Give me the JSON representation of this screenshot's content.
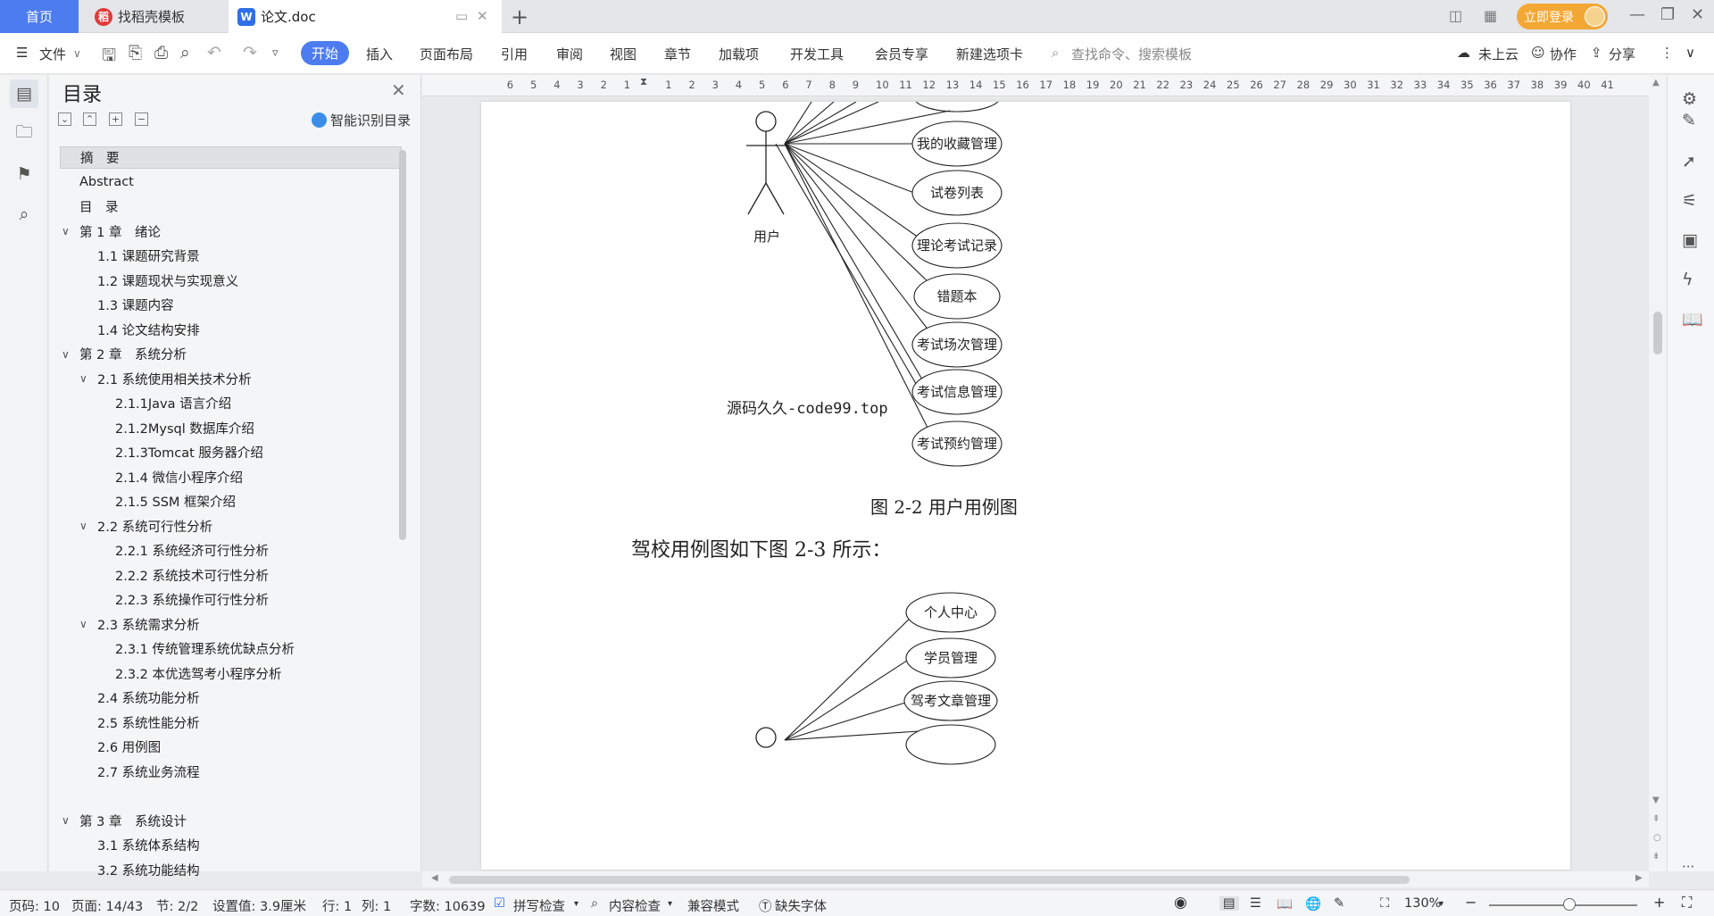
{
  "tabs": {
    "home": "首页",
    "template": "找稻壳模板",
    "doc": "论文.doc",
    "add": "+"
  },
  "titlebar": {
    "login": "立即登录"
  },
  "menu": {
    "file": "文件",
    "items": [
      "开始",
      "插入",
      "页面布局",
      "引用",
      "审阅",
      "视图",
      "章节",
      "加载项",
      "开发工具",
      "会员专享",
      "新建选项卡"
    ],
    "search_placeholder": "查找命令、搜索模板",
    "cloud": "未上云",
    "collab": "协作",
    "share": "分享"
  },
  "toc": {
    "title": "目录",
    "smart": "智能识别目录",
    "items": [
      {
        "label": "摘　要",
        "level": 0,
        "caret": false,
        "selected": true
      },
      {
        "label": "Abstract",
        "level": 0,
        "caret": false
      },
      {
        "label": "目　录",
        "level": 0,
        "caret": false
      },
      {
        "label": "第 1 章　绪论",
        "level": 0,
        "caret": true
      },
      {
        "label": "1.1 课题研究背景",
        "level": 1,
        "caret": false
      },
      {
        "label": "1.2 课题现状与实现意义",
        "level": 1,
        "caret": false
      },
      {
        "label": "1.3 课题内容",
        "level": 1,
        "caret": false
      },
      {
        "label": "1.4 论文结构安排",
        "level": 1,
        "caret": false
      },
      {
        "label": "第 2 章　系统分析",
        "level": 0,
        "caret": true
      },
      {
        "label": "2.1 系统使用相关技术分析",
        "level": 1,
        "caret": true
      },
      {
        "label": "2.1.1Java 语言介绍",
        "level": 2,
        "caret": false
      },
      {
        "label": "2.1.2Mysql 数据库介绍",
        "level": 2,
        "caret": false
      },
      {
        "label": "2.1.3Tomcat 服务器介绍",
        "level": 2,
        "caret": false
      },
      {
        "label": "2.1.4 微信小程序介绍",
        "level": 2,
        "caret": false
      },
      {
        "label": "2.1.5 SSM 框架介绍",
        "level": 2,
        "caret": false
      },
      {
        "label": "2.2 系统可行性分析",
        "level": 1,
        "caret": true
      },
      {
        "label": "2.2.1 系统经济可行性分析",
        "level": 2,
        "caret": false
      },
      {
        "label": "2.2.2 系统技术可行性分析",
        "level": 2,
        "caret": false
      },
      {
        "label": "2.2.3 系统操作可行性分析",
        "level": 2,
        "caret": false
      },
      {
        "label": "2.3 系统需求分析",
        "level": 1,
        "caret": true
      },
      {
        "label": "2.3.1 传统管理系统优缺点分析",
        "level": 2,
        "caret": false
      },
      {
        "label": "2.3.2 本优选驾考小程序分析",
        "level": 2,
        "caret": false
      },
      {
        "label": "2.4 系统功能分析",
        "level": 1,
        "caret": false
      },
      {
        "label": "2.5 系统性能分析",
        "level": 1,
        "caret": false
      },
      {
        "label": "2.6 用例图",
        "level": 1,
        "caret": false
      },
      {
        "label": "2.7 系统业务流程",
        "level": 1,
        "caret": false
      },
      {
        "label": "",
        "level": 0,
        "caret": false
      },
      {
        "label": "第 3 章　系统设计",
        "level": 0,
        "caret": true
      },
      {
        "label": "3.1 系统体系结构",
        "level": 1,
        "caret": false
      },
      {
        "label": "3.2 系统功能结构",
        "level": 1,
        "caret": false
      }
    ]
  },
  "ruler": {
    "left_ticks": [
      "6",
      "5",
      "4",
      "3",
      "2",
      "1"
    ],
    "right_ticks": [
      "1",
      "2",
      "3",
      "4",
      "5",
      "6",
      "7",
      "8",
      "9",
      "10",
      "11",
      "12",
      "13",
      "14",
      "15",
      "16",
      "17",
      "18",
      "19",
      "20",
      "21",
      "22",
      "23",
      "24",
      "25",
      "26",
      "27",
      "28",
      "29",
      "30",
      "31",
      "32",
      "33",
      "34",
      "35",
      "36",
      "37",
      "38",
      "39",
      "40",
      "41"
    ]
  },
  "document": {
    "actor_label": "用户",
    "use_cases_1": [
      "我的收藏管理",
      "试卷列表",
      "理论考试记录",
      "错题本",
      "考试场次管理",
      "考试信息管理",
      "考试预约管理"
    ],
    "watermark": "源码久久-code99.top",
    "caption": "图 2-2 用户用例图",
    "paragraph": "驾校用例图如下图 2-3 所示：",
    "use_cases_2": [
      "个人中心",
      "学员管理",
      "驾考文章管理"
    ]
  },
  "status": {
    "page_code": "页码: 10",
    "page": "页面: 14/43",
    "section": "节: 2/2",
    "setting": "设置值: 3.9厘米",
    "row": "行: 1",
    "col": "列: 1",
    "word_count": "字数: 10639",
    "spell": "拼写检查",
    "content": "内容检查",
    "compat": "兼容模式",
    "font_missing": "缺失字体",
    "zoom": "130%"
  }
}
